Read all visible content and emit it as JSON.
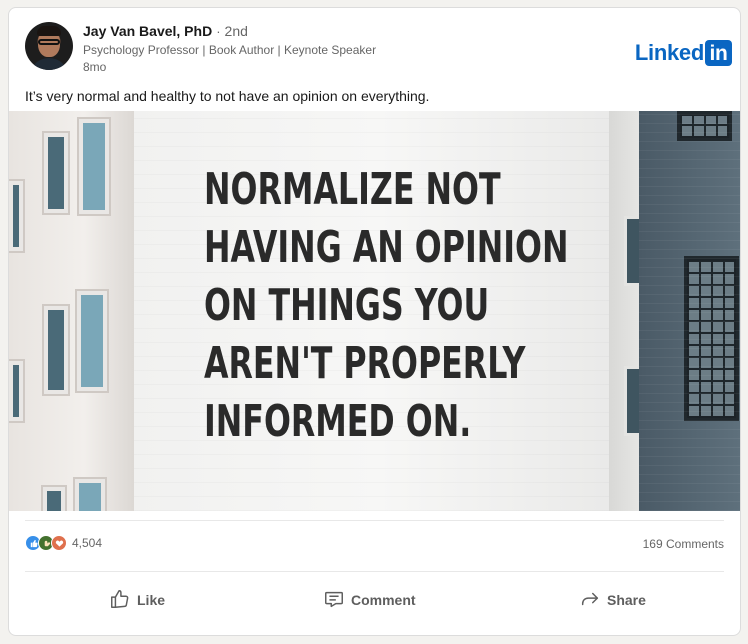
{
  "author": {
    "name": "Jay Van Bavel, PhD",
    "degree": "2nd",
    "separator": "·",
    "headline": "Psychology Professor | Book Author | Keynote Speaker",
    "time": "8mo"
  },
  "brand": {
    "text": "Linked",
    "box": "in",
    "color": "#0a66c2"
  },
  "post": {
    "text": "It’s very normal and healthy to not have an opinion on everything.",
    "image_text": [
      "NORMALIZE NOT",
      "HAVING AN OPINION",
      "ON THINGS YOU",
      "AREN'T PROPERLY",
      "INFORMED ON."
    ]
  },
  "social": {
    "reaction_icons": [
      "like-icon",
      "celebrate-icon",
      "love-icon"
    ],
    "reaction_count": "4,504",
    "comments": "169 Comments"
  },
  "actions": {
    "like": "Like",
    "comment": "Comment",
    "share": "Share"
  }
}
